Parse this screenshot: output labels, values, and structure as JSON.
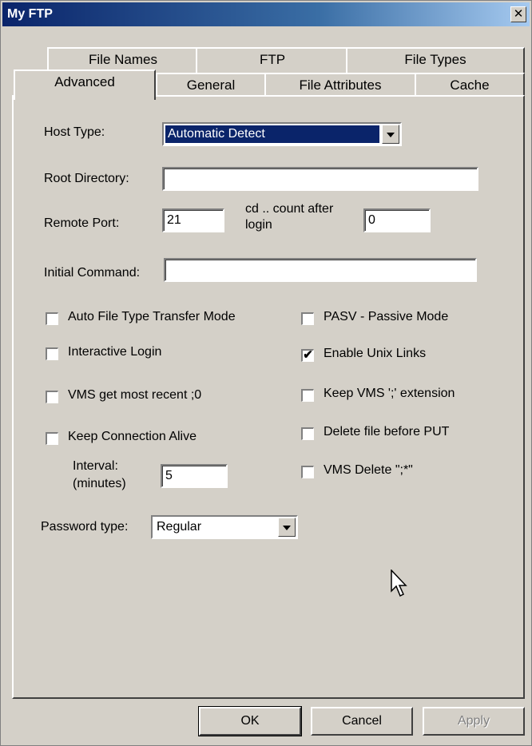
{
  "window": {
    "title": "My FTP",
    "close_symbol": "✕"
  },
  "tabs": {
    "back_row": [
      "File Names",
      "FTP",
      "File Types"
    ],
    "front_row": [
      "Advanced",
      "General",
      "File Attributes",
      "Cache"
    ],
    "active": "Advanced"
  },
  "form": {
    "host_type": {
      "label": "Host Type:",
      "value": "Automatic Detect"
    },
    "root_directory": {
      "label": "Root Directory:",
      "value": ""
    },
    "remote_port": {
      "label": "Remote Port:",
      "value": "21"
    },
    "cd_count": {
      "label_line1": "cd ..  count after",
      "label_line2": "login",
      "value": "0"
    },
    "initial_command": {
      "label": "Initial Command:",
      "value": ""
    },
    "checkboxes_left": [
      {
        "label": "Auto File Type Transfer Mode",
        "checked": false
      },
      {
        "label": "Interactive Login",
        "checked": false
      },
      {
        "label": "VMS get most recent ;0",
        "checked": false
      },
      {
        "label": "Keep Connection Alive",
        "checked": false
      }
    ],
    "checkboxes_right": [
      {
        "label": "PASV - Passive Mode",
        "checked": false
      },
      {
        "label": "Enable Unix Links",
        "checked": true
      },
      {
        "label": "Keep VMS ';' extension",
        "checked": false
      },
      {
        "label": "Delete file before PUT",
        "checked": false
      },
      {
        "label": "VMS Delete \";*\"",
        "checked": false
      }
    ],
    "interval": {
      "label_line1": "Interval:",
      "label_line2": "(minutes)",
      "value": "5"
    },
    "password_type": {
      "label": "Password type:",
      "value": "Regular"
    }
  },
  "buttons": {
    "ok": "OK",
    "cancel": "Cancel",
    "apply": "Apply"
  },
  "icons": {
    "checkmark": "✔",
    "close": "close-icon",
    "cursor": "mouse-pointer-icon"
  }
}
